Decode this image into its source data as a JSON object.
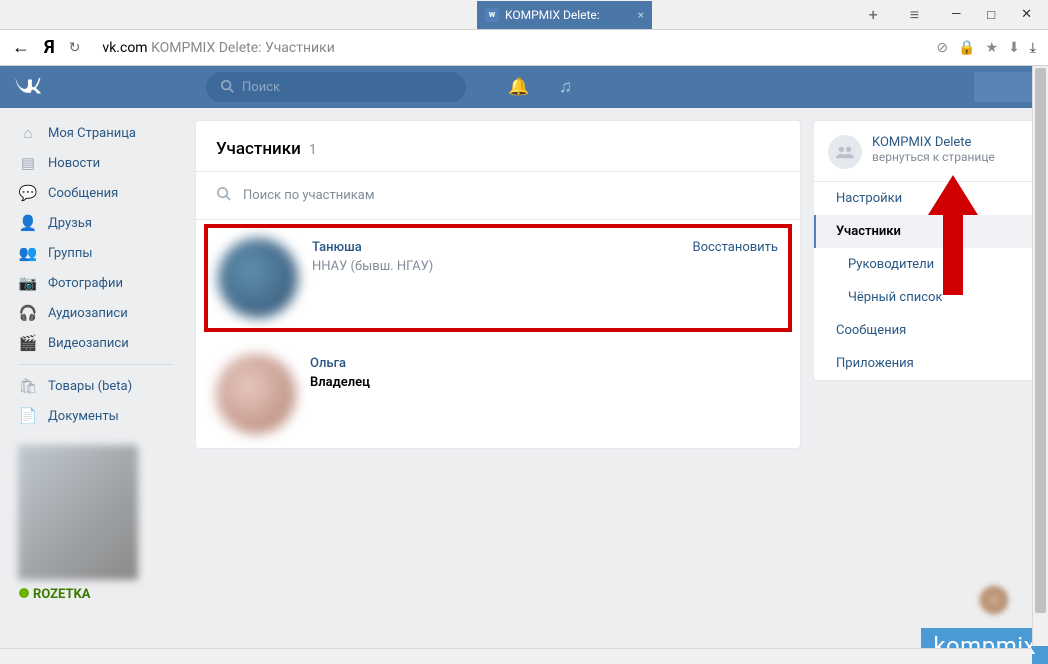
{
  "browser": {
    "tab_title": "KOMPMIX Delete:",
    "url_domain": "vk.com",
    "url_rest": "KOMPMIX Delete: Участники"
  },
  "vk": {
    "search_placeholder": "Поиск"
  },
  "sidebar": {
    "items": [
      {
        "label": "Моя Страница",
        "icon": "home"
      },
      {
        "label": "Новости",
        "icon": "news"
      },
      {
        "label": "Сообщения",
        "icon": "messages"
      },
      {
        "label": "Друзья",
        "icon": "friends"
      },
      {
        "label": "Группы",
        "icon": "groups"
      },
      {
        "label": "Фотографии",
        "icon": "photos"
      },
      {
        "label": "Аудиозаписи",
        "icon": "audio"
      },
      {
        "label": "Видеозаписи",
        "icon": "video"
      }
    ],
    "items2": [
      {
        "label": "Товары (beta)",
        "icon": "market"
      },
      {
        "label": "Документы",
        "icon": "docs"
      }
    ],
    "ad_brand": "ROZETKA"
  },
  "panel": {
    "title": "Участники",
    "count": "1",
    "search_placeholder": "Поиск по участникам",
    "members": [
      {
        "name": "Танюша",
        "info": "ННАУ (бывш. НГАУ)",
        "action": "Восстановить"
      },
      {
        "name": "Ольга",
        "role": "Владелец"
      }
    ]
  },
  "right": {
    "group_name": "KOMPMIX Delete",
    "back_link": "вернуться к странице",
    "items": [
      {
        "label": "Настройки",
        "type": "top"
      },
      {
        "label": "Участники",
        "type": "active"
      },
      {
        "label": "Руководители",
        "type": "sub"
      },
      {
        "label": "Чёрный список",
        "type": "sub"
      },
      {
        "label": "Сообщения",
        "type": "top"
      },
      {
        "label": "Приложения",
        "type": "top"
      }
    ]
  },
  "watermark": "kompmix"
}
